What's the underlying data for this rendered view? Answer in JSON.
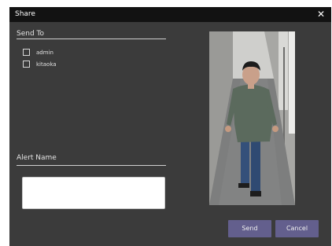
{
  "dialog": {
    "title": "Share",
    "close_icon": "close-icon (×)"
  },
  "send_to": {
    "label": "Send To",
    "recipients": [
      {
        "label": "admin",
        "checked": false
      },
      {
        "label": "kitaoka",
        "checked": false
      }
    ]
  },
  "alert_name": {
    "label": "Alert Name",
    "value": "",
    "placeholder": ""
  },
  "snapshot": {
    "icon": "camera-snapshot-image (person walking in hallway)"
  },
  "buttons": {
    "send_label": "Send",
    "cancel_label": "Cancel"
  },
  "colors": {
    "dialog_bg": "#3b3b3b",
    "titlebar_bg": "#121212",
    "button_bg": "#635f8d",
    "text": "#e4e4e4"
  }
}
